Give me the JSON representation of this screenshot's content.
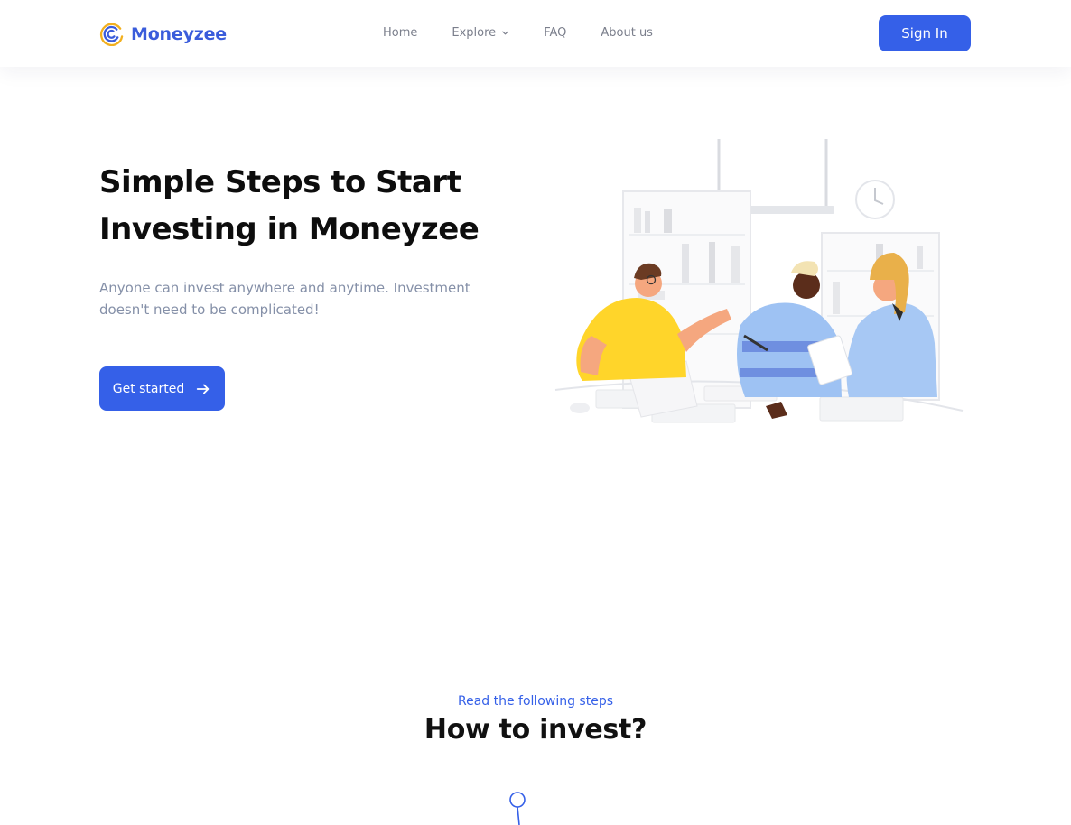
{
  "brand": {
    "name": "Moneyzee",
    "logo_icon": "spiral-logo-icon",
    "accent": "#3560e8"
  },
  "nav": {
    "items": [
      {
        "label": "Home"
      },
      {
        "label": "Explore",
        "icon": "chevron-down-icon"
      },
      {
        "label": "FAQ"
      },
      {
        "label": "About us"
      }
    ],
    "sign_in": "Sign In"
  },
  "hero": {
    "title_line1": "Simple Steps to Start",
    "title_line2": "Investing in Moneyzee",
    "subtitle": "Anyone can invest anywhere and anytime. Investment doesn't need to be complicated!",
    "cta_label": "Get started",
    "cta_icon": "arrow-right-icon",
    "illustration": "team-meeting-illustration"
  },
  "steps": {
    "kicker": "Read the following steps",
    "title": "How to invest?",
    "marker_icon": "timeline-pin-icon"
  }
}
